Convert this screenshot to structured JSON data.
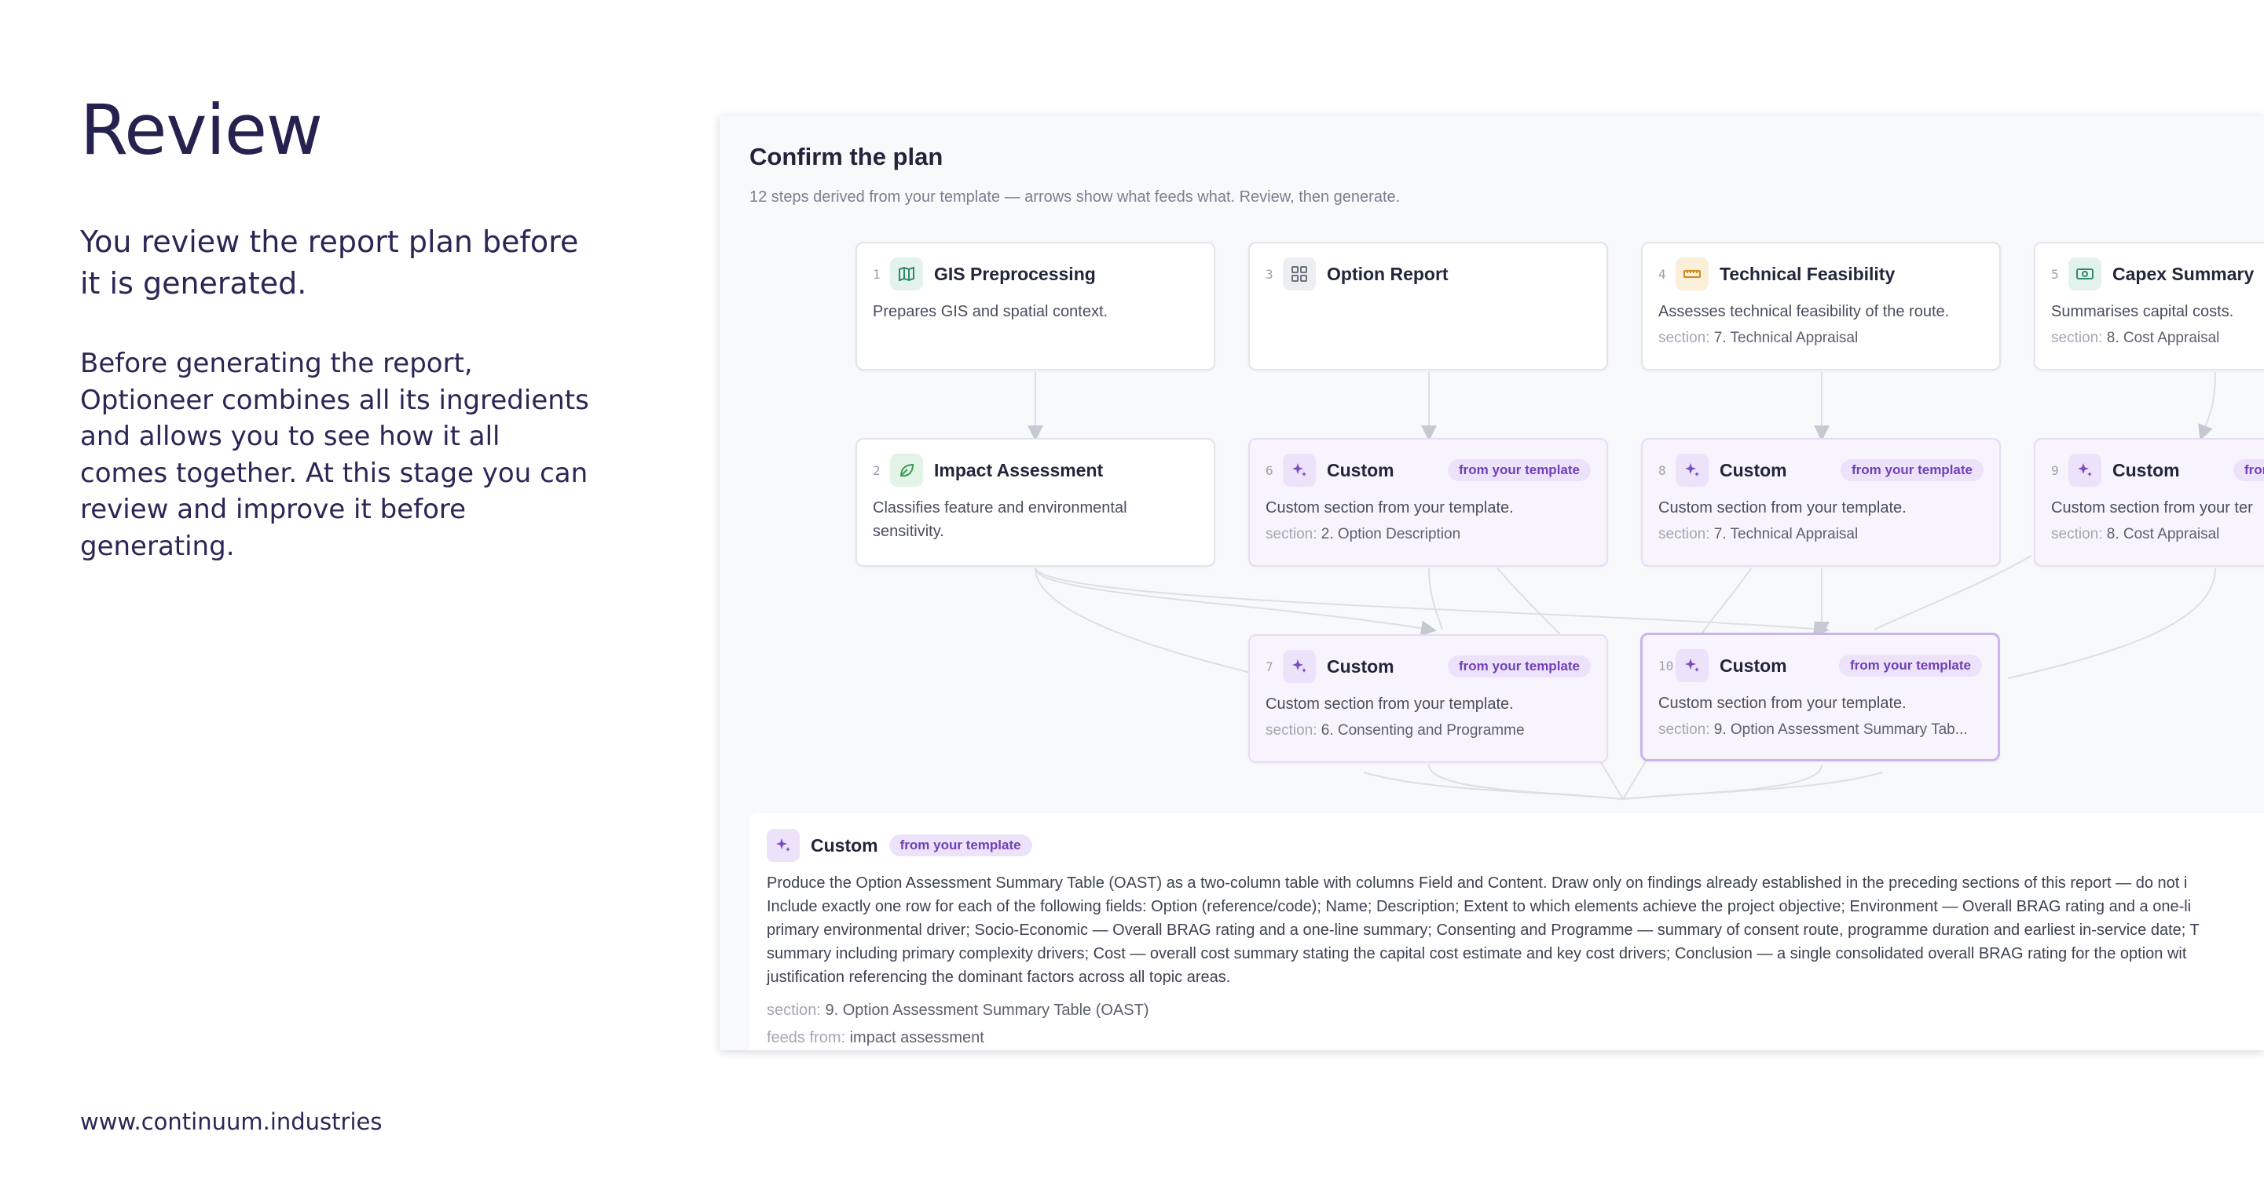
{
  "slide": {
    "title": "Review",
    "lead": "You review the report plan before it is generated.",
    "body": "Before generating the report, Optioneer combines all its ingredients and allows you to see how it all comes together. At this stage you can review and improve it before generating.",
    "footer_url": "www.continuum.industries"
  },
  "plan": {
    "title": "Confirm the plan",
    "subtitle": "12 steps derived from your template — arrows show what feeds what. Review, then generate.",
    "section_prefix": "section:",
    "badge_label": "from your template",
    "nodes": [
      {
        "num": "1",
        "icon": "map-icon",
        "title": "GIS Preprocessing",
        "desc": "Prepares GIS and spatial context.",
        "section": ""
      },
      {
        "num": "3",
        "icon": "grid-icon",
        "title": "Option Report",
        "desc": "",
        "section": ""
      },
      {
        "num": "4",
        "icon": "ruler-icon",
        "title": "Technical Feasibility",
        "desc": "Assesses technical feasibility of the route.",
        "section": "7. Technical Appraisal"
      },
      {
        "num": "5",
        "icon": "banknote-icon",
        "title": "Capex Summary",
        "desc": "Summarises capital costs.",
        "section": "8. Cost Appraisal"
      },
      {
        "num": "2",
        "icon": "leaf-icon",
        "title": "Impact Assessment",
        "desc": "Classifies feature and environmental sensitivity.",
        "section": ""
      },
      {
        "num": "6",
        "icon": "sparkle-icon",
        "title": "Custom",
        "desc": "Custom section from your template.",
        "section": "2. Option Description"
      },
      {
        "num": "8",
        "icon": "sparkle-icon",
        "title": "Custom",
        "desc": "Custom section from your template.",
        "section": "7. Technical Appraisal"
      },
      {
        "num": "9",
        "icon": "sparkle-icon",
        "title": "Custom",
        "desc": "Custom section from your ter",
        "section": "8. Cost Appraisal"
      },
      {
        "num": "7",
        "icon": "sparkle-icon",
        "title": "Custom",
        "desc": "Custom section from your template.",
        "section": "6. Consenting and Programme"
      },
      {
        "num": "10",
        "icon": "sparkle-icon",
        "title": "Custom",
        "desc": "Custom section from your template.",
        "section": "9. Option Assessment Summary Tab..."
      }
    ],
    "detail": {
      "title": "Custom",
      "icon": "sparkle-icon",
      "body": "Produce the Option Assessment Summary Table (OAST) as a two-column table with columns Field and Content. Draw only on findings already established in the preceding sections of this report — do not i\nInclude exactly one row for each of the following fields: Option (reference/code); Name; Description; Extent to which elements achieve the project objective; Environment — Overall BRAG rating and a one-li\nprimary environmental driver; Socio-Economic — Overall BRAG rating and a one-line summary; Consenting and Programme — summary of consent route, programme duration and earliest in-service date; T\nsummary including primary complexity drivers; Cost — overall cost summary stating the capital cost estimate and key cost drivers; Conclusion — a single consolidated overall BRAG rating for the option wit\njustification referencing the dominant factors across all topic areas.",
      "section_label": "section:",
      "section": "9. Option Assessment Summary Table (OAST)",
      "feeds_label": "feeds from:",
      "feeds": "impact assessment"
    }
  }
}
